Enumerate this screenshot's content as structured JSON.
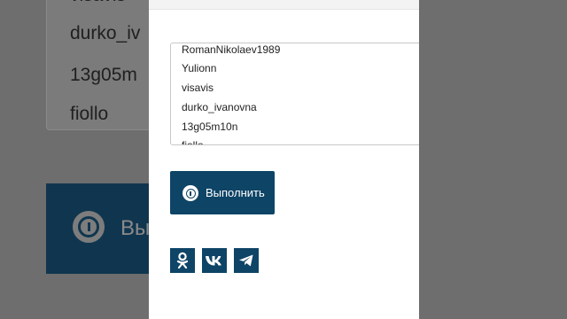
{
  "background_preview": {
    "list_items": [
      "visavis",
      "durko_iv",
      "13g05m",
      "fiollo"
    ],
    "button_label": "Вы"
  },
  "user_list": {
    "items": [
      "RomanNikolaev1989",
      "Yulionn",
      "visavis",
      "durko_ivanovna",
      "13g05m10n",
      "fiollo"
    ]
  },
  "run_button": {
    "label": "Выполнить"
  },
  "share": {
    "icons": [
      "odnoklassniki-icon",
      "vk-icon",
      "telegram-icon"
    ]
  },
  "colors": {
    "accent": "#0e4466",
    "overlay": "#6e6e6e"
  }
}
